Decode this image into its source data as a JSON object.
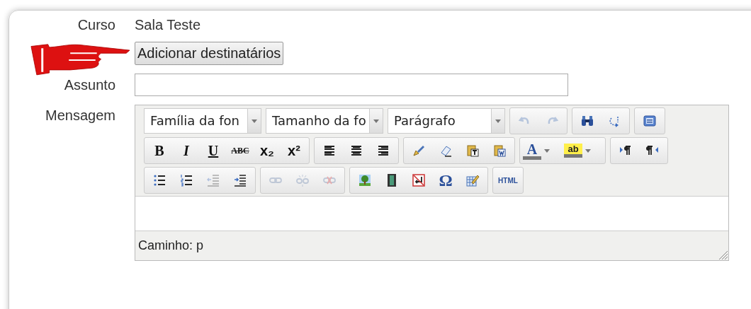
{
  "form": {
    "fields": [
      {
        "kind": "text",
        "label": "Curso",
        "value": "Sala Teste"
      },
      {
        "kind": "button",
        "button": "Adicionar destinatários"
      },
      {
        "kind": "input",
        "label": "Assunto"
      },
      {
        "kind": "editor",
        "label": "Mensagem"
      }
    ]
  },
  "editor": {
    "selects": [
      "Família da fon",
      "Tamanho da fo",
      "Parágrafo"
    ],
    "toolbar": [
      [
        [
          {
            "kind": "icon",
            "disabled": true
          },
          {
            "kind": "icon",
            "disabled": true
          }
        ],
        [
          {
            "kind": "icon",
            "disabled": false
          },
          {
            "kind": "icon",
            "disabled": false
          }
        ],
        [
          {
            "kind": "icon",
            "disabled": false
          }
        ]
      ],
      [
        [
          {
            "kind": "glyph",
            "label": "B",
            "disabled": false
          },
          {
            "kind": "glyph",
            "label": "I",
            "disabled": false
          },
          {
            "kind": "glyph",
            "label": "U",
            "disabled": false
          },
          {
            "kind": "glyph",
            "label": "ABC",
            "disabled": false
          },
          {
            "kind": "glyph",
            "label": "x₂",
            "disabled": false
          },
          {
            "kind": "glyph",
            "label": "x²",
            "disabled": false
          }
        ],
        [
          {
            "kind": "icon",
            "disabled": false
          },
          {
            "kind": "icon",
            "disabled": false
          },
          {
            "kind": "icon",
            "disabled": false
          }
        ],
        [
          {
            "kind": "icon",
            "disabled": false
          },
          {
            "kind": "icon",
            "disabled": false
          },
          {
            "kind": "icon",
            "disabled": false
          },
          {
            "kind": "icon",
            "disabled": false
          }
        ],
        [
          {
            "kind": "color",
            "label": "A",
            "disabled": false
          },
          {
            "kind": "color",
            "label": "ab",
            "disabled": false
          }
        ],
        [
          {
            "kind": "icon",
            "disabled": false
          },
          {
            "kind": "icon",
            "disabled": false
          }
        ]
      ],
      [
        [
          {
            "kind": "icon",
            "disabled": false
          },
          {
            "kind": "icon",
            "disabled": false
          },
          {
            "kind": "icon",
            "disabled": true
          },
          {
            "kind": "icon",
            "disabled": false
          }
        ],
        [
          {
            "kind": "icon",
            "disabled": true
          },
          {
            "kind": "icon",
            "disabled": true
          },
          {
            "kind": "icon",
            "disabled": true
          }
        ],
        [
          {
            "kind": "icon",
            "disabled": false
          },
          {
            "kind": "icon",
            "disabled": false
          },
          {
            "kind": "icon",
            "disabled": false
          },
          {
            "kind": "glyph",
            "label": "Ω",
            "disabled": false
          },
          {
            "kind": "icon",
            "disabled": false
          }
        ],
        [
          {
            "kind": "glyph",
            "label": "HTML",
            "disabled": false
          }
        ]
      ]
    ],
    "path": "Caminho: p"
  }
}
